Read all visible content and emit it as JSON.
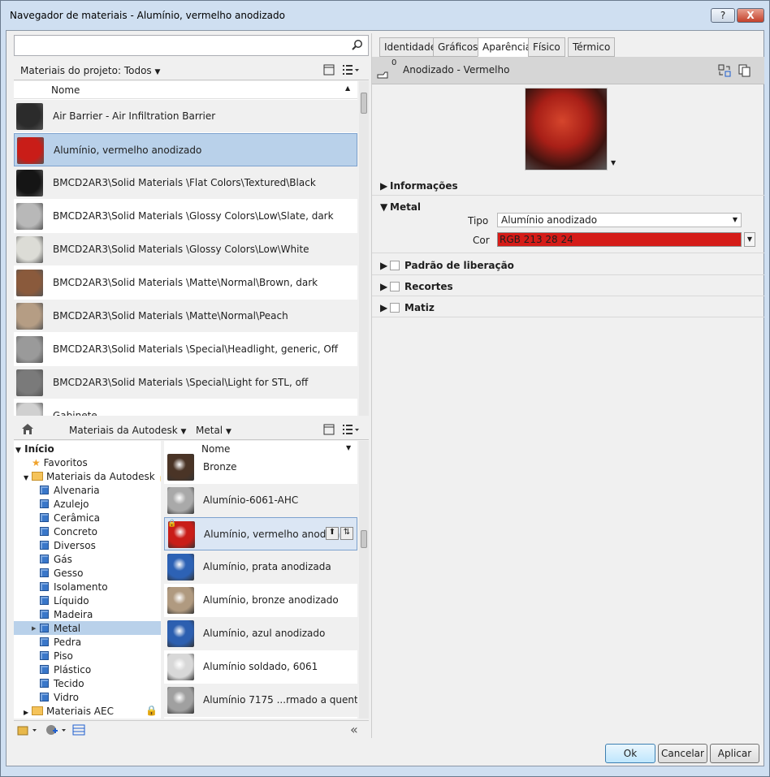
{
  "window": {
    "title": "Navegador de materiais - Alumínio, vermelho anodizado",
    "help": "?",
    "close": "X"
  },
  "search": {
    "value": "",
    "placeholder": ""
  },
  "project": {
    "filter": "Materiais do projeto: Todos",
    "col_name": "Nome",
    "rows": [
      {
        "label": "Air Barrier - Air Infiltration Barrier",
        "color": "#2b2b2b"
      },
      {
        "label": "Alumínio, vermelho anodizado",
        "color": "#c91d18"
      },
      {
        "label": "BMCD2AR3\\Solid Materials \\Flat Colors\\Textured\\Black",
        "color": "#151515"
      },
      {
        "label": "BMCD2AR3\\Solid Materials \\Glossy Colors\\Low\\Slate, dark",
        "color": "#b8b8b8"
      },
      {
        "label": "BMCD2AR3\\Solid Materials \\Glossy Colors\\Low\\White",
        "color": "#dcdcd6"
      },
      {
        "label": "BMCD2AR3\\Solid Materials \\Matte\\Normal\\Brown, dark",
        "color": "#8a5a3c"
      },
      {
        "label": "BMCD2AR3\\Solid Materials \\Matte\\Normal\\Peach",
        "color": "#b59d84"
      },
      {
        "label": "BMCD2AR3\\Solid Materials \\Special\\Headlight, generic, Off",
        "color": "#9a9a9a"
      },
      {
        "label": "BMCD2AR3\\Solid Materials \\Special\\Light for STL, off",
        "color": "#7a7a7a"
      },
      {
        "label": "Gabinete",
        "color": "#d0d0d0"
      }
    ]
  },
  "library": {
    "home": "Início",
    "lib": "Materiais da Autodesk",
    "cat": "Metal",
    "col_name": "Nome",
    "tree": {
      "root": "Início",
      "favorites": "Favoritos",
      "autodesk": "Materiais da Autodesk",
      "cats": [
        "Alvenaria",
        "Azulejo",
        "Cerâmica",
        "Concreto",
        "Diversos",
        "Gás",
        "Gesso",
        "Isolamento",
        "Líquido",
        "Madeira",
        "Metal",
        "Pedra",
        "Piso",
        "Plástico",
        "Tecido",
        "Vidro"
      ],
      "aec": "Materiais AEC"
    },
    "rows": [
      {
        "label": "Bronze",
        "color": "#4a3426"
      },
      {
        "label": "Alumínio-6061-AHC",
        "color": "#a9a9a9"
      },
      {
        "label": "Alumínio, vermelho anodiza",
        "color": "#c91d18"
      },
      {
        "label": "Alumínio, prata anodizada",
        "color": "#2d62b5"
      },
      {
        "label": "Alumínio, bronze anodizado",
        "color": "#b09a80"
      },
      {
        "label": "Alumínio, azul anodizado",
        "color": "#2c5fb0"
      },
      {
        "label": "Alumínio soldado, 6061",
        "color": "#d8d8d8"
      },
      {
        "label": "Alumínio 7175 ...rmado a quente",
        "color": "#a0a0a0"
      }
    ]
  },
  "editor": {
    "tabs": [
      "Identidade",
      "Gráficos",
      "Aparência",
      "Físico",
      "Térmico"
    ],
    "asset_count": "0",
    "asset_name": "Anodizado - Vermelho",
    "sections": {
      "info": "Informações",
      "metal": "Metal",
      "pattern": "Padrão de liberação",
      "cutouts": "Recortes",
      "tint": "Matiz"
    },
    "tipo_label": "Tipo",
    "tipo_value": "Alumínio anodizado",
    "cor_label": "Cor",
    "cor_value": "RGB 213 28 24",
    "cor_color": "#d51c18"
  },
  "buttons": {
    "ok": "Ok",
    "cancel": "Cancelar",
    "apply": "Aplicar"
  }
}
